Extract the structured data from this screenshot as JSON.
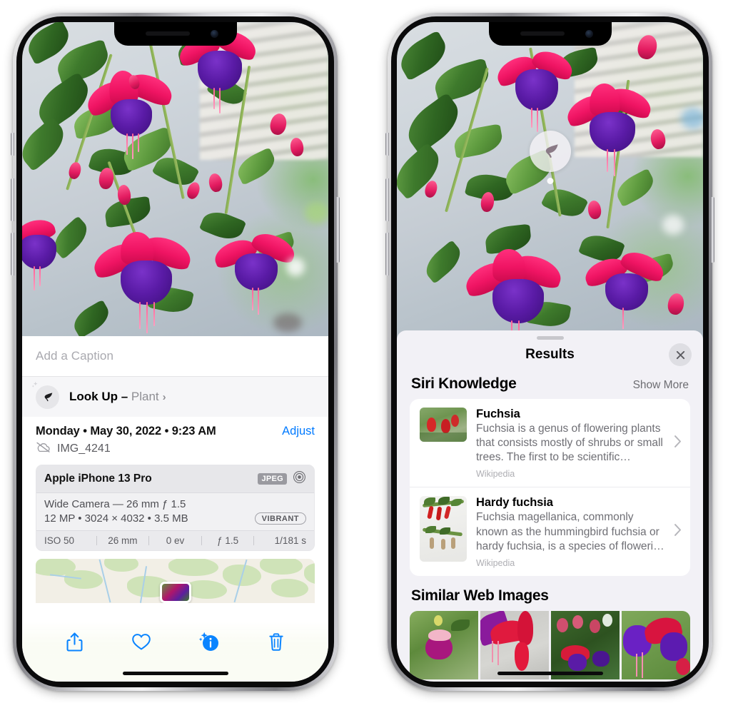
{
  "left_phone": {
    "caption": {
      "placeholder": "Add a Caption",
      "value": ""
    },
    "look_up": {
      "label": "Look Up –",
      "subject": "Plant",
      "chevron": "›",
      "icon": "leaf-icon"
    },
    "info": {
      "date_line": "Monday • May 30, 2022 • 9:23 AM",
      "adjust_label": "Adjust",
      "file_name": "IMG_4241",
      "cloud_icon": "cloud-slash-icon"
    },
    "exif": {
      "device": "Apple iPhone 13 Pro",
      "format_badge": "JPEG",
      "lens_icon": "aperture-icon",
      "lens_line": "Wide Camera — 26 mm ƒ 1.5",
      "spec_line": "12 MP • 3024 × 4032 • 3.5 MB",
      "style_badge": "VIBRANT",
      "settings": [
        "ISO 50",
        "26 mm",
        "0 ev",
        "ƒ 1.5",
        "1/181 s"
      ]
    },
    "toolbar": [
      {
        "name": "share-button",
        "icon": "share-icon"
      },
      {
        "name": "favorite-button",
        "icon": "heart-icon"
      },
      {
        "name": "info-button",
        "icon": "info-sparkle-icon"
      },
      {
        "name": "delete-button",
        "icon": "trash-icon"
      }
    ]
  },
  "right_phone": {
    "visual_look_up_badge": {
      "icon": "leaf-icon"
    },
    "panel": {
      "title": "Results",
      "close_icon": "close-icon",
      "sections": [
        {
          "title": "Siri Knowledge",
          "action_label": "Show More",
          "items": [
            {
              "title": "Fuchsia",
              "description": "Fuchsia is a genus of flowering plants that consists mostly of shrubs or small trees. The first to be scientific…",
              "source": "Wikipedia",
              "chevron": "›"
            },
            {
              "title": "Hardy fuchsia",
              "description": "Fuchsia magellanica, commonly known as the hummingbird fuchsia or hardy fuchsia, is a species of floweri…",
              "source": "Wikipedia",
              "chevron": "›"
            }
          ]
        },
        {
          "title": "Similar Web Images",
          "thumbnails": [
            "web-image-1",
            "web-image-2",
            "web-image-3",
            "web-image-4"
          ]
        }
      ]
    }
  },
  "colors": {
    "accent_blue": "#007AFF",
    "panel_bg": "#f2f1f6",
    "card_bg": "#ffffff",
    "secondary_text": "#6f6f75"
  }
}
